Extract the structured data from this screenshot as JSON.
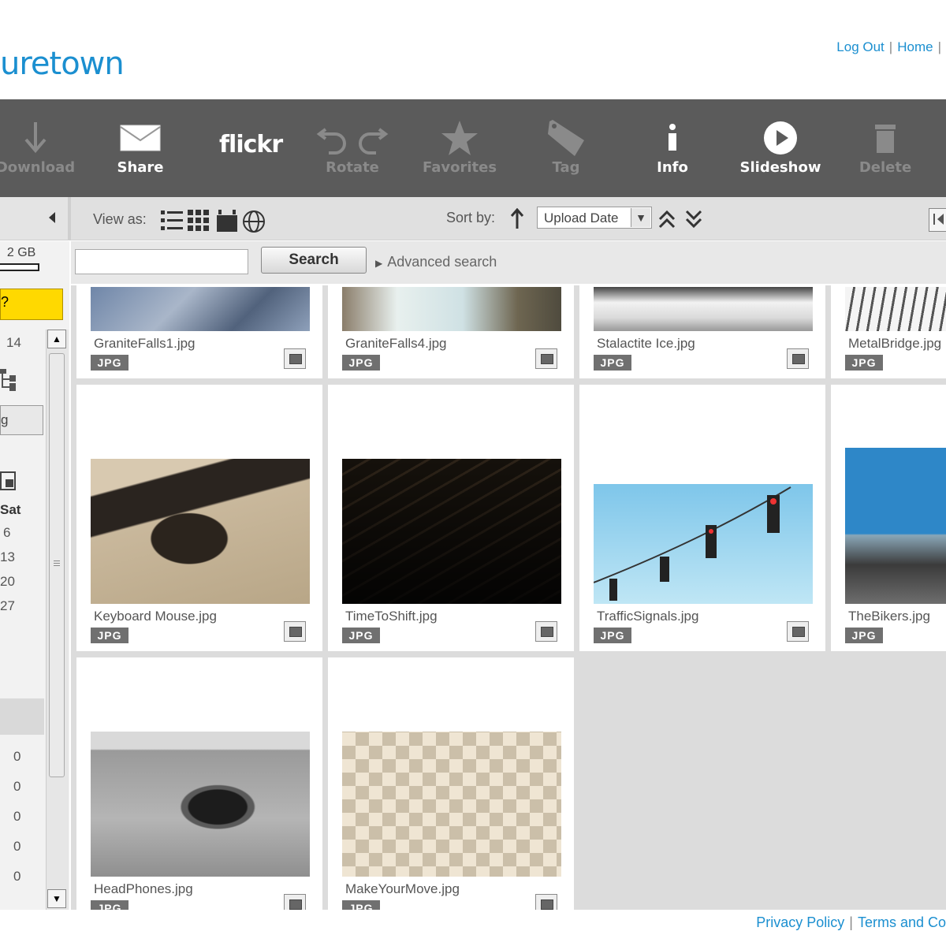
{
  "header": {
    "logo": "uretown",
    "links": [
      "Log Out",
      "Home"
    ]
  },
  "toolbar": {
    "download": "Download",
    "share": "Share",
    "flickr": "flickr",
    "rotate": "Rotate",
    "favorites": "Favorites",
    "tag": "Tag",
    "info": "Info",
    "slideshow": "Slideshow",
    "delete": "Delete"
  },
  "viewbar": {
    "view_as": "View as:",
    "sort_by": "Sort by:",
    "sort_value": "Upload Date"
  },
  "search": {
    "button": "Search",
    "advanced": "Advanced search"
  },
  "left": {
    "quota": "2 GB",
    "yellow": "?",
    "count": "14",
    "folder": "g",
    "sat": "Sat",
    "days": [
      "6",
      "13",
      "20",
      "27"
    ],
    "zeros": [
      "0",
      "0",
      "0",
      "0",
      "0"
    ]
  },
  "photos": [
    {
      "name": "GraniteFalls1.jpg",
      "type": "JPG"
    },
    {
      "name": "GraniteFalls4.jpg",
      "type": "JPG"
    },
    {
      "name": "Stalactite Ice.jpg",
      "type": "JPG"
    },
    {
      "name": "MetalBridge.jpg",
      "type": "JPG"
    },
    {
      "name": "Keyboard Mouse.jpg",
      "type": "JPG"
    },
    {
      "name": "TimeToShift.jpg",
      "type": "JPG"
    },
    {
      "name": "TrafficSignals.jpg",
      "type": "JPG"
    },
    {
      "name": "TheBikers.jpg",
      "type": "JPG"
    },
    {
      "name": "HeadPhones.jpg",
      "type": "JPG"
    },
    {
      "name": "MakeYourMove.jpg",
      "type": "JPG"
    }
  ],
  "footer": {
    "privacy": "Privacy Policy",
    "terms": "Terms and Co"
  },
  "colors": {
    "accent": "#1b8fd0",
    "toolbar": "#5b5b5b",
    "highlight": "#ffd900"
  }
}
